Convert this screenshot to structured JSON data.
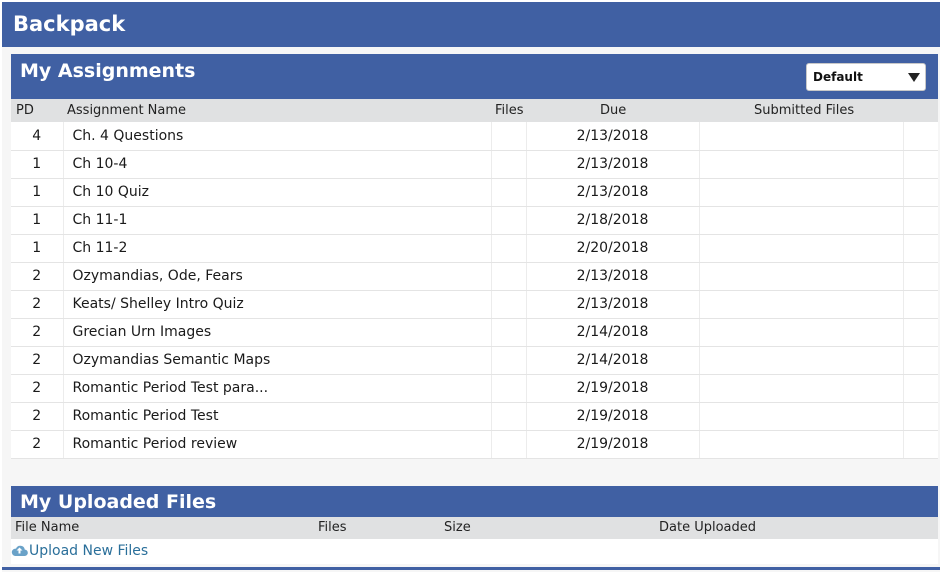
{
  "app": {
    "title": "Backpack"
  },
  "assignments": {
    "title": "My Assignments",
    "sort": {
      "selected": "Default"
    },
    "columns": {
      "pd": "PD",
      "name": "Assignment Name",
      "files": "Files",
      "due": "Due",
      "submitted": "Submitted Files"
    },
    "rows": [
      {
        "pd": "4",
        "name": "Ch. 4 Questions",
        "due": "2/13/2018"
      },
      {
        "pd": "1",
        "name": "Ch 10-4",
        "due": "2/13/2018"
      },
      {
        "pd": "1",
        "name": "Ch 10 Quiz",
        "due": "2/13/2018"
      },
      {
        "pd": "1",
        "name": "Ch 11-1",
        "due": "2/18/2018"
      },
      {
        "pd": "1",
        "name": "Ch 11-2",
        "due": "2/20/2018"
      },
      {
        "pd": "2",
        "name": "Ozymandias, Ode, Fears",
        "due": "2/13/2018"
      },
      {
        "pd": "2",
        "name": "Keats/ Shelley Intro Quiz",
        "due": "2/13/2018"
      },
      {
        "pd": "2",
        "name": "Grecian Urn Images",
        "due": "2/14/2018"
      },
      {
        "pd": "2",
        "name": "Ozymandias Semantic Maps",
        "due": "2/14/2018"
      },
      {
        "pd": "2",
        "name": "Romantic Period Test para...",
        "due": "2/19/2018"
      },
      {
        "pd": "2",
        "name": "Romantic Period Test",
        "due": "2/19/2018"
      },
      {
        "pd": "2",
        "name": "Romantic Period review",
        "due": "2/19/2018"
      }
    ]
  },
  "uploads": {
    "title": "My Uploaded Files",
    "columns": {
      "name": "File Name",
      "files": "Files",
      "size": "Size",
      "date": "Date Uploaded"
    },
    "upload_label": "Upload New Files"
  },
  "icons": {
    "upload": "cloud-upload-icon",
    "dropdown": "caret-down-icon"
  },
  "colors": {
    "brand": "#4060a3",
    "link": "#2a6f9a",
    "header_row": "#e0e1e2"
  }
}
